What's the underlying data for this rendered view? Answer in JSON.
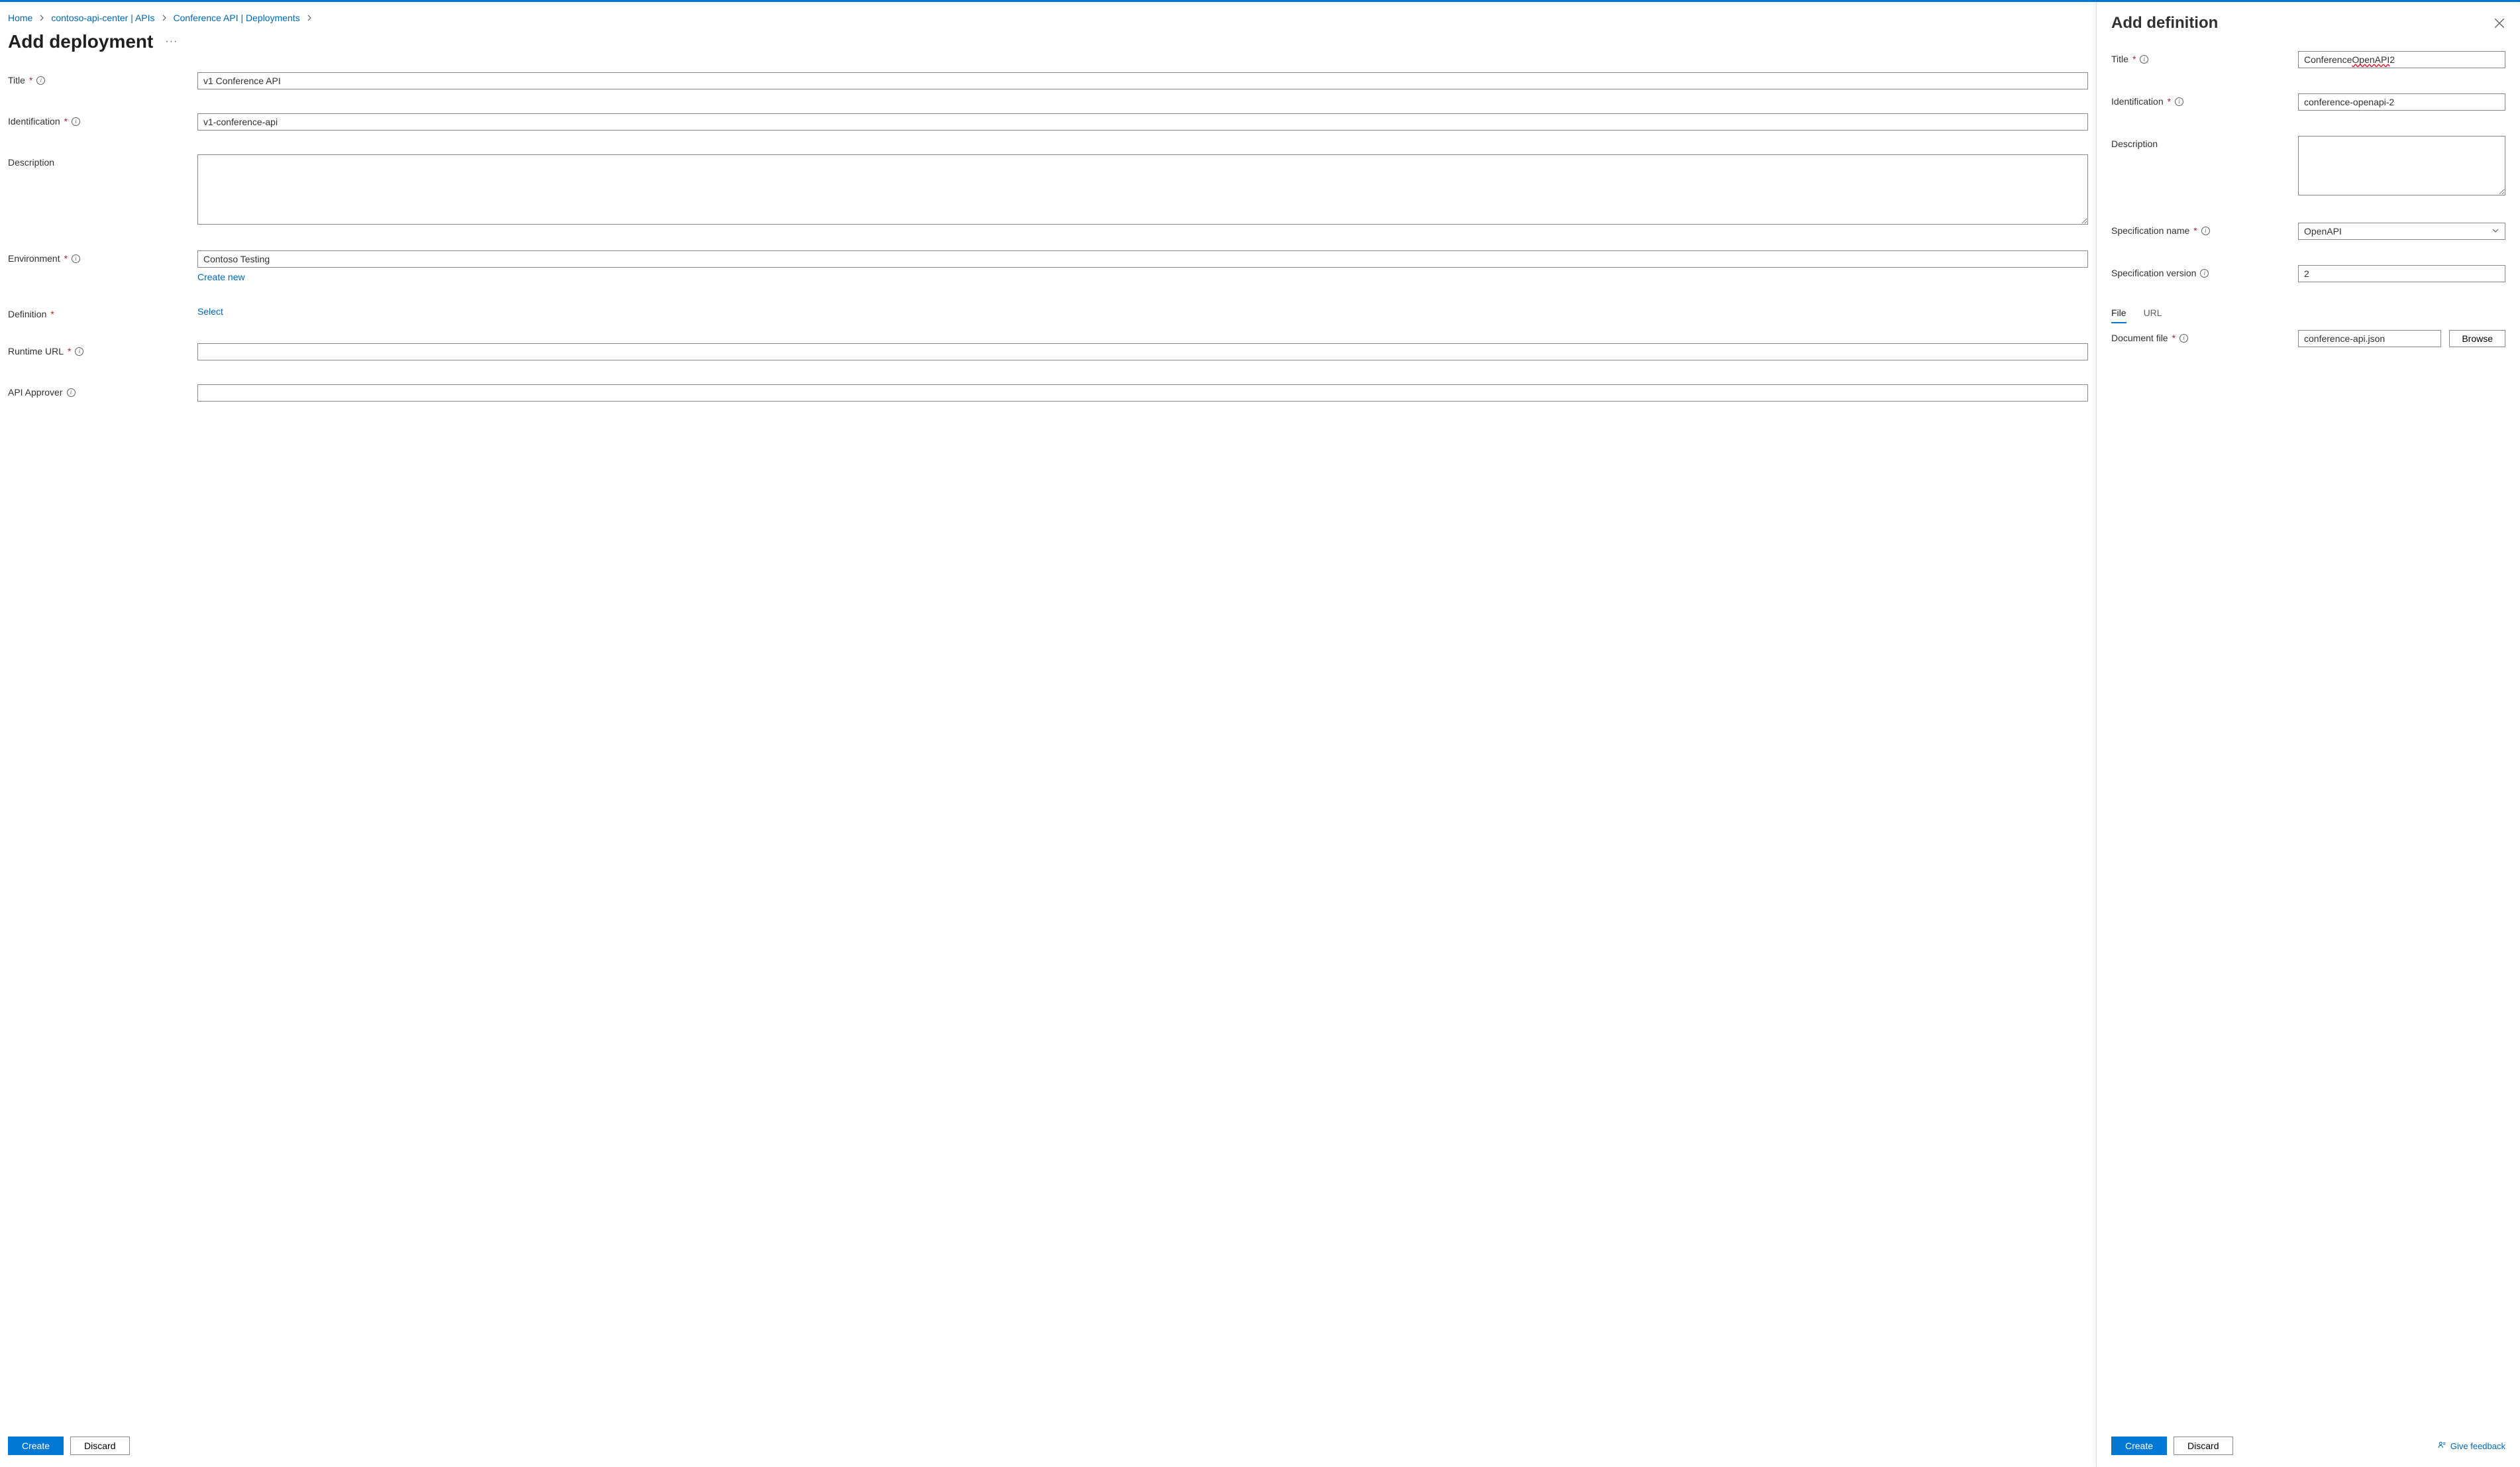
{
  "breadcrumbs": [
    {
      "label": "Home"
    },
    {
      "label": "contoso-api-center | APIs"
    },
    {
      "label": "Conference API | Deployments"
    }
  ],
  "main": {
    "page_title": "Add deployment",
    "fields": {
      "title": {
        "label": "Title",
        "value": "v1 Conference API",
        "required": true,
        "info": true
      },
      "identification": {
        "label": "Identification",
        "value": "v1-conference-api",
        "required": true,
        "info": true
      },
      "description": {
        "label": "Description",
        "value": ""
      },
      "environment": {
        "label": "Environment",
        "value": "Contoso Testing",
        "required": true,
        "info": true,
        "create_new": "Create new"
      },
      "definition": {
        "label": "Definition",
        "required": true,
        "select_link": "Select"
      },
      "runtime_url": {
        "label": "Runtime URL",
        "value": "",
        "required": true,
        "info": true
      },
      "api_approver": {
        "label": "API Approver",
        "value": "",
        "info": true
      }
    },
    "footer": {
      "create": "Create",
      "discard": "Discard"
    }
  },
  "panel": {
    "title": "Add definition",
    "fields": {
      "title": {
        "label": "Title",
        "value_pre": "Conference ",
        "value_err": "OpenAPI",
        "value_post": " 2",
        "required": true,
        "info": true
      },
      "identification": {
        "label": "Identification",
        "value": "conference-openapi-2",
        "required": true,
        "info": true
      },
      "description": {
        "label": "Description",
        "value": ""
      },
      "spec_name": {
        "label": "Specification name",
        "value": "OpenAPI",
        "required": true,
        "info": true
      },
      "spec_version": {
        "label": "Specification version",
        "value": "2",
        "info": true
      },
      "tabs": {
        "file": "File",
        "url": "URL"
      },
      "document_file": {
        "label": "Document file",
        "value": "conference-api.json",
        "required": true,
        "info": true,
        "browse": "Browse"
      }
    },
    "footer": {
      "create": "Create",
      "discard": "Discard",
      "feedback": "Give feedback"
    }
  }
}
